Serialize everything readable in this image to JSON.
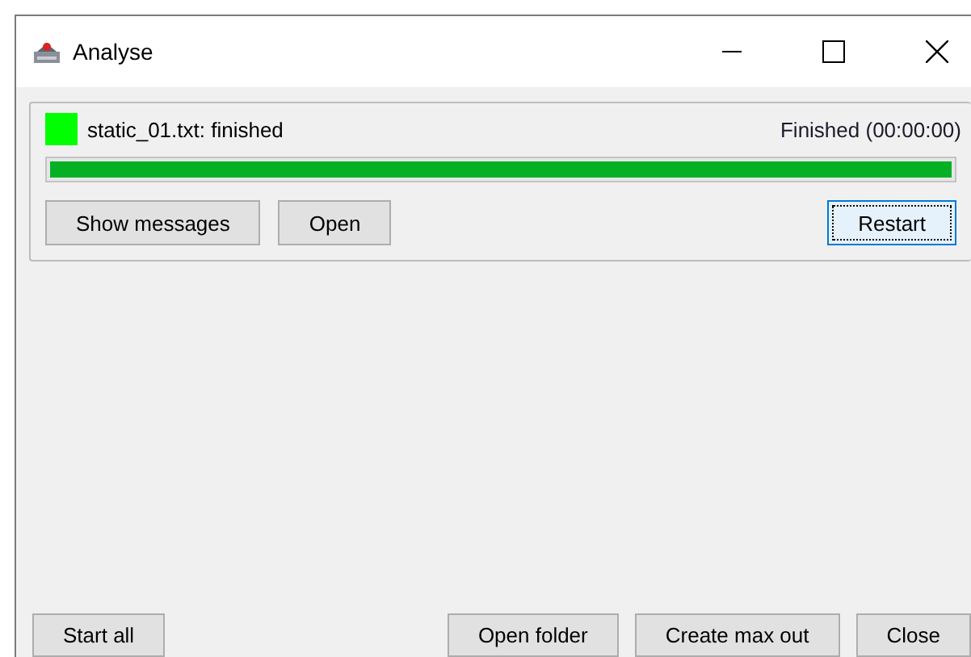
{
  "window": {
    "title": "Analyse"
  },
  "jobs": [
    {
      "color": "#00ff00",
      "label": "static_01.txt: finished",
      "state_text": "Finished (00:00:00)",
      "level": 1,
      "buttons": [
        {
          "label": "Show messages",
          "focused": false
        },
        {
          "label": "Open",
          "focused": false
        },
        {
          "label": "Restart",
          "focused": true
        }
      ]
    }
  ],
  "footer_buttons": [
    "Start all",
    "Open folder",
    "Create max out",
    "Close"
  ]
}
